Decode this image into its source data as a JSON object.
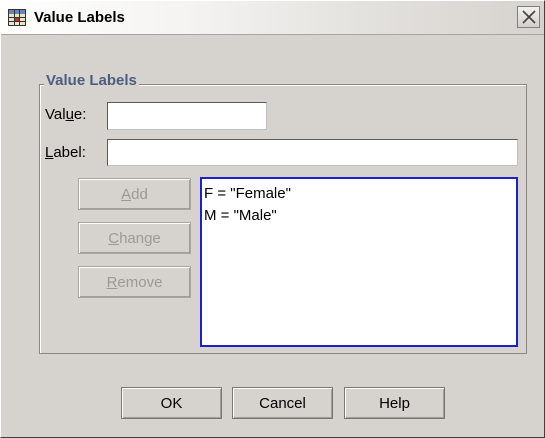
{
  "window": {
    "title": "Value Labels",
    "icon": "grid-icon",
    "close_icon": "close-icon"
  },
  "group": {
    "title": "Value Labels"
  },
  "value_field": {
    "label_pre": "Val",
    "label_mnemonic": "u",
    "label_post": "e:",
    "value": ""
  },
  "label_field": {
    "label_pre": "",
    "label_mnemonic": "L",
    "label_post": "abel:",
    "value": ""
  },
  "side_buttons": {
    "add": {
      "mnemonic": "A",
      "rest": "dd",
      "enabled": false
    },
    "change": {
      "mnemonic": "C",
      "rest": "hange",
      "enabled": false
    },
    "remove": {
      "mnemonic": "R",
      "rest": "emove",
      "enabled": false
    }
  },
  "labels_list": [
    "F = \"Female\"",
    "M = \"Male\""
  ],
  "dialog_buttons": {
    "ok": "OK",
    "cancel": "Cancel",
    "help": "Help"
  },
  "colors": {
    "dialog_bg": "#d6d3ce",
    "group_title": "#4b5e82",
    "list_border": "#1f1fc8"
  }
}
